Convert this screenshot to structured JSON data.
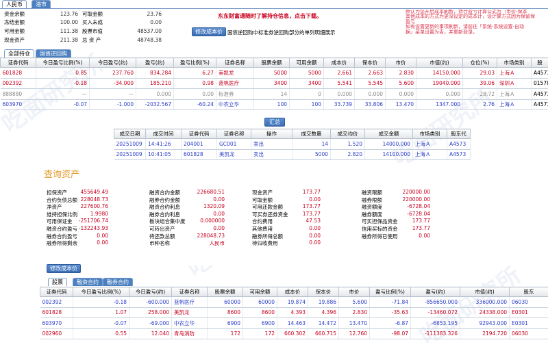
{
  "colors": {
    "blue_accent": "#4a7fc0",
    "red": "#c8001e",
    "blue_text": "#2b3ec9",
    "notice": "#d9354c"
  },
  "top": {
    "currency_tabs": [
      "人民币",
      "港市"
    ],
    "summary_rows": [
      [
        "资金余额",
        "123.76",
        "可取金额",
        "23.76"
      ],
      [
        "冻结金额",
        "100.00",
        "买入未成",
        "0.00"
      ],
      [
        "可用金额",
        "111.38",
        "股票市值",
        "48537.00"
      ],
      [
        "现金资产",
        "211.38",
        "总 资 产",
        "48748.38"
      ]
    ],
    "promo": "东东财富通随时了解持仓信息，点击下载。",
    "modify_cost_button": "修改成本价",
    "repo_note": "国债逆回购中标准券逆回购部分的单列明细展示",
    "notice_lines": [
      "默认为您开启成本刷新，持仓盈亏计算公式为（市价-保本",
      "其他成本的方式为更深设定的成本计，设计算方式因为保留保",
      "盈亏",
      "如有设置更新的事项刷新，请前往「系统-系统设置-自动",
      "据」菜单设置为否，并重新登录。"
    ],
    "tabs": [
      "全部持仓",
      "国债逆回购"
    ]
  },
  "holdings": {
    "headers": [
      "证券代码",
      "今日盈亏比例(%)",
      "今日盈亏(约)",
      "盈亏(约)",
      "盈亏比例(%)",
      "证券名称",
      "股票余额",
      "可用余额",
      "成本价",
      "保本价",
      "市价",
      "市值(约)",
      "仓位(%)",
      "市场类别",
      "股"
    ],
    "rows": [
      [
        "601828",
        "0.85",
        "237.760",
        "834.284",
        "6.27",
        "美凯龙",
        "5000",
        "5000",
        "2.661",
        "2.663",
        "2.830",
        "14150.000",
        "29.03",
        "上海Ａ",
        "A4573"
      ],
      [
        "002392",
        "-0.18",
        "-34.000",
        "185.210",
        "0.98",
        "蓝帆医疗",
        "3400",
        "3400",
        "5.541",
        "5.545",
        "5.600",
        "19040.000",
        "39.06",
        "深圳Ａ",
        "01578"
      ],
      [
        "888880",
        "—",
        "—",
        "0.000",
        "0.00",
        "标准券",
        "14",
        "0",
        "0.000",
        "0.000",
        "0.000",
        "0.000",
        "28.72",
        "上海Ａ",
        "A4573"
      ],
      [
        "603970",
        "-0.07",
        "-1.000",
        "-2032.567",
        "-60.24",
        "中农立华",
        "100",
        "100",
        "33.739",
        "33.806",
        "13.470",
        "1347.000",
        "2.76",
        "上海Ａ",
        "A4573"
      ]
    ]
  },
  "summary_button": "汇总",
  "trades": {
    "headers": [
      "成交日期",
      "成交时间",
      "证券代码",
      "证券名称",
      "操作",
      "成交数量",
      "成交均价",
      "成交金额",
      "市场类别",
      "股东代"
    ],
    "rows": [
      [
        "20251009",
        "14:41:26",
        "204001",
        "GC001",
        "卖出",
        "14",
        "1.520",
        "14000.000",
        "上海Ａ",
        "A4573"
      ],
      [
        "20251009",
        "10:41:05",
        "601828",
        "美凯龙",
        "卖出",
        "5000",
        "2.820",
        "14100.000",
        "上海Ａ",
        "A4573"
      ]
    ]
  },
  "assets": {
    "title": "查询资产",
    "rows": [
      [
        "担保资产",
        "455649.49",
        "融资合约金额",
        "226680.51",
        "现金资产",
        "173.77",
        "融资限额",
        "220000.00"
      ],
      [
        "合约负债总额",
        "228048.73",
        "融券合约金额",
        "0.00",
        "可取金额",
        "0.00",
        "融券限额",
        "220000.00"
      ],
      [
        "净资产",
        "227600.76",
        "融资合约利息",
        "1320.09",
        "可用还款金额",
        "173.77",
        "融资额度",
        "-6728.04"
      ],
      [
        "维持担保比例",
        "1.9980",
        "融券合约利息",
        "0.00",
        "可买券还券资金",
        "173.77",
        "融券额度",
        "-6728.04"
      ],
      [
        "可用保证金",
        "-251706.74",
        "板块组合集中度",
        "0.000000",
        "合约费用",
        "47.53",
        "可买担保品资金",
        "173.77"
      ],
      [
        "融资合约盈亏",
        "-132243.93",
        "可转出资产",
        "0.00",
        "其他费用",
        "0.00",
        "信用买标的资金",
        "173.77"
      ],
      [
        "融券合约盈亏",
        "0.00",
        "待还款总额",
        "228048.73",
        "融券所得总额",
        "0.00",
        "融券所得已使用",
        "0.00"
      ],
      [
        "融券所得剩余",
        "0.00",
        "币种名称",
        "人民币",
        "待归收费用",
        "0.00",
        "",
        ""
      ]
    ],
    "modify_cost_button": "修改成本价",
    "tabs": [
      "股票",
      "融资合约",
      "融券合约"
    ]
  },
  "credit": {
    "headers": [
      "证券代码",
      "今日盈亏比例(%)",
      "今日盈亏(约)",
      "证券名称",
      "股票余额",
      "可用余额",
      "成本价",
      "保本价",
      "市价",
      "盈亏比例(%)",
      "盈亏(约)",
      "市值(约)",
      "股东"
    ],
    "rows": [
      [
        "002392",
        "-0.18",
        "-600.000",
        "蓝帆医疗",
        "60000",
        "60000",
        "19.874",
        "19.886",
        "5.600",
        "-71.84",
        "-856650.000",
        "336000.000",
        "06030"
      ],
      [
        "601828",
        "1.07",
        "258.000",
        "美凯龙",
        "8600",
        "8600",
        "4.393",
        "4.396",
        "2.830",
        "-35.63",
        "-13460.072",
        "24338.000",
        "E0301"
      ],
      [
        "603970",
        "-0.07",
        "-69.000",
        "中农立华",
        "6900",
        "6900",
        "14.463",
        "14.472",
        "13.470",
        "-6.87",
        "-6853.195",
        "92943.000",
        "E0301"
      ],
      [
        "002960",
        "0.55",
        "12.040",
        "青岛消防",
        "172",
        "172",
        "660.302",
        "660.715",
        "12.760",
        "-98.07",
        "-111383.326",
        "2194.720",
        "06030"
      ]
    ]
  },
  "watermarks": [
    "吃面研究所",
    "吃面研究所",
    "吃面研究所",
    "吃面研究所"
  ]
}
